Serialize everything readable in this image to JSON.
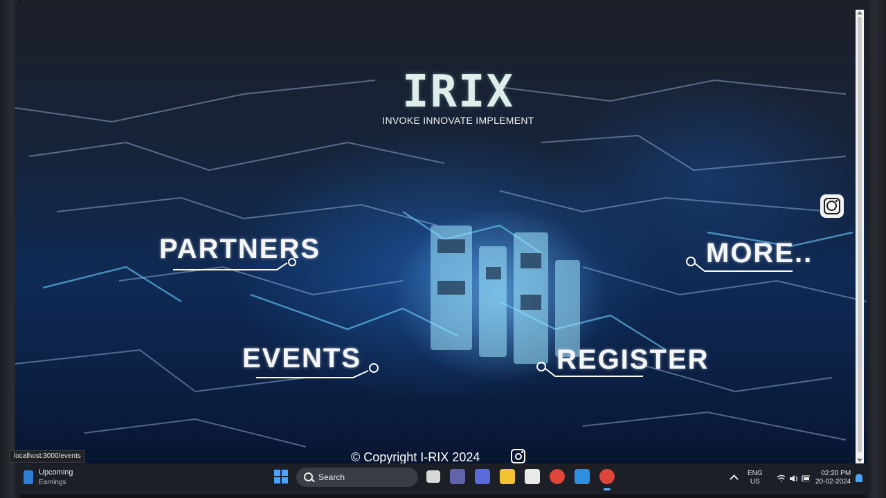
{
  "site": {
    "logo_text": "I-RIX",
    "logo_display": "IRIX",
    "tagline": "INVOKE INNOVATE IMPLEMENT"
  },
  "nav": {
    "partners": "PARTNERS",
    "more": "MORE..",
    "events": "EVENTS",
    "register": "REGISTER"
  },
  "footer": {
    "copyright": "© Copyright I-RIX 2024"
  },
  "status_bar": {
    "url": "localhost:3000/events"
  },
  "taskbar": {
    "weather_title": "Upcoming",
    "weather_subtitle": "Earnings",
    "search_label": "Search",
    "apps": [
      "file-explorer-task-view",
      "teams",
      "visual-studio",
      "file-explorer",
      "store",
      "chrome",
      "vscode",
      "chrome-active"
    ],
    "language_line1": "ENG",
    "language_line2": "US",
    "time": "02:20 PM",
    "date": "20-02-2024"
  },
  "colors": {
    "link_text": "#f4f6f7",
    "glow": "#6bd9ff",
    "taskbar": "#1c1f26",
    "accent": "#4aa3ff"
  }
}
